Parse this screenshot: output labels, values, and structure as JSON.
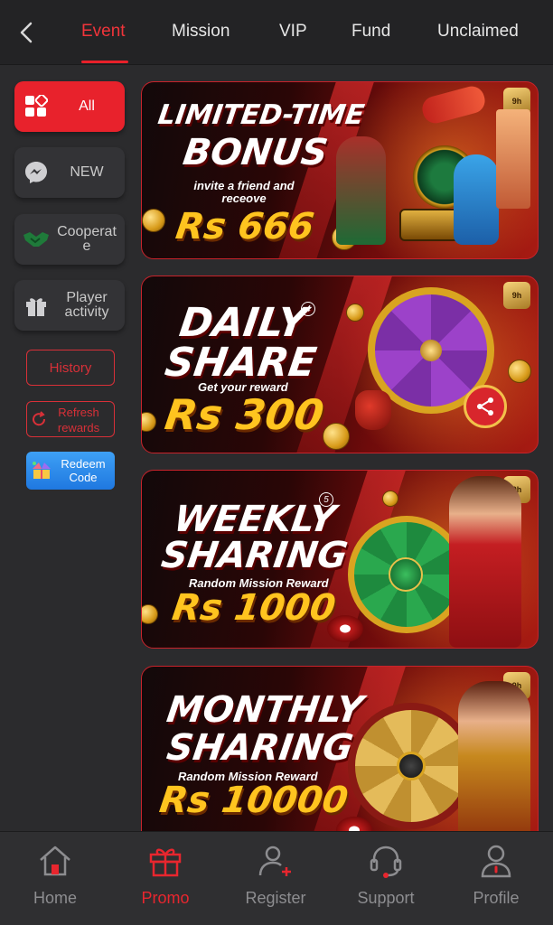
{
  "tabs": [
    {
      "label": "Event",
      "active": true
    },
    {
      "label": "Mission",
      "active": false
    },
    {
      "label": "VIP",
      "active": false
    },
    {
      "label": "Fund",
      "active": false
    },
    {
      "label": "Unclaimed",
      "active": false
    }
  ],
  "sidebar": {
    "items": [
      {
        "label": "All",
        "icon": "grid-icon",
        "active": true
      },
      {
        "label": "NEW",
        "icon": "messenger-icon",
        "active": false
      },
      {
        "label": "Cooperat e",
        "icon": "handshake-icon",
        "active": false
      },
      {
        "label": "Player activity",
        "icon": "gift-icon",
        "active": false
      }
    ],
    "history_label": "History",
    "refresh_label": "Refresh rewards",
    "redeem_label": "Redeem Code"
  },
  "banners": [
    {
      "title_line1": "LIMITED-TIME",
      "title_line2": "BONUS",
      "subtitle": "invite a friend and receove",
      "amount": "Rs 666",
      "number": ""
    },
    {
      "title_line1": "DAILY",
      "title_line2": "SHARE",
      "subtitle": "Get your reward",
      "amount": "Rs 300",
      "number": "4"
    },
    {
      "title_line1": "WEEKLY",
      "title_line2": "SHARING",
      "subtitle": "Random Mission Reward",
      "amount": "Rs 1000",
      "number": "5"
    },
    {
      "title_line1": "MONTHLY",
      "title_line2": "SHARING",
      "subtitle": "Random Mission Reward",
      "amount": "Rs 10000",
      "number": ""
    }
  ],
  "bottom_nav": [
    {
      "label": "Home",
      "icon": "home-icon",
      "active": false
    },
    {
      "label": "Promo",
      "icon": "gift-icon",
      "active": true
    },
    {
      "label": "Register",
      "icon": "add-user-icon",
      "active": false
    },
    {
      "label": "Support",
      "icon": "headset-icon",
      "active": false
    },
    {
      "label": "Profile",
      "icon": "profile-icon",
      "active": false
    }
  ],
  "colors": {
    "accent": "#e8262e",
    "background": "#2b2b2d",
    "gold": "#ffc41f"
  }
}
